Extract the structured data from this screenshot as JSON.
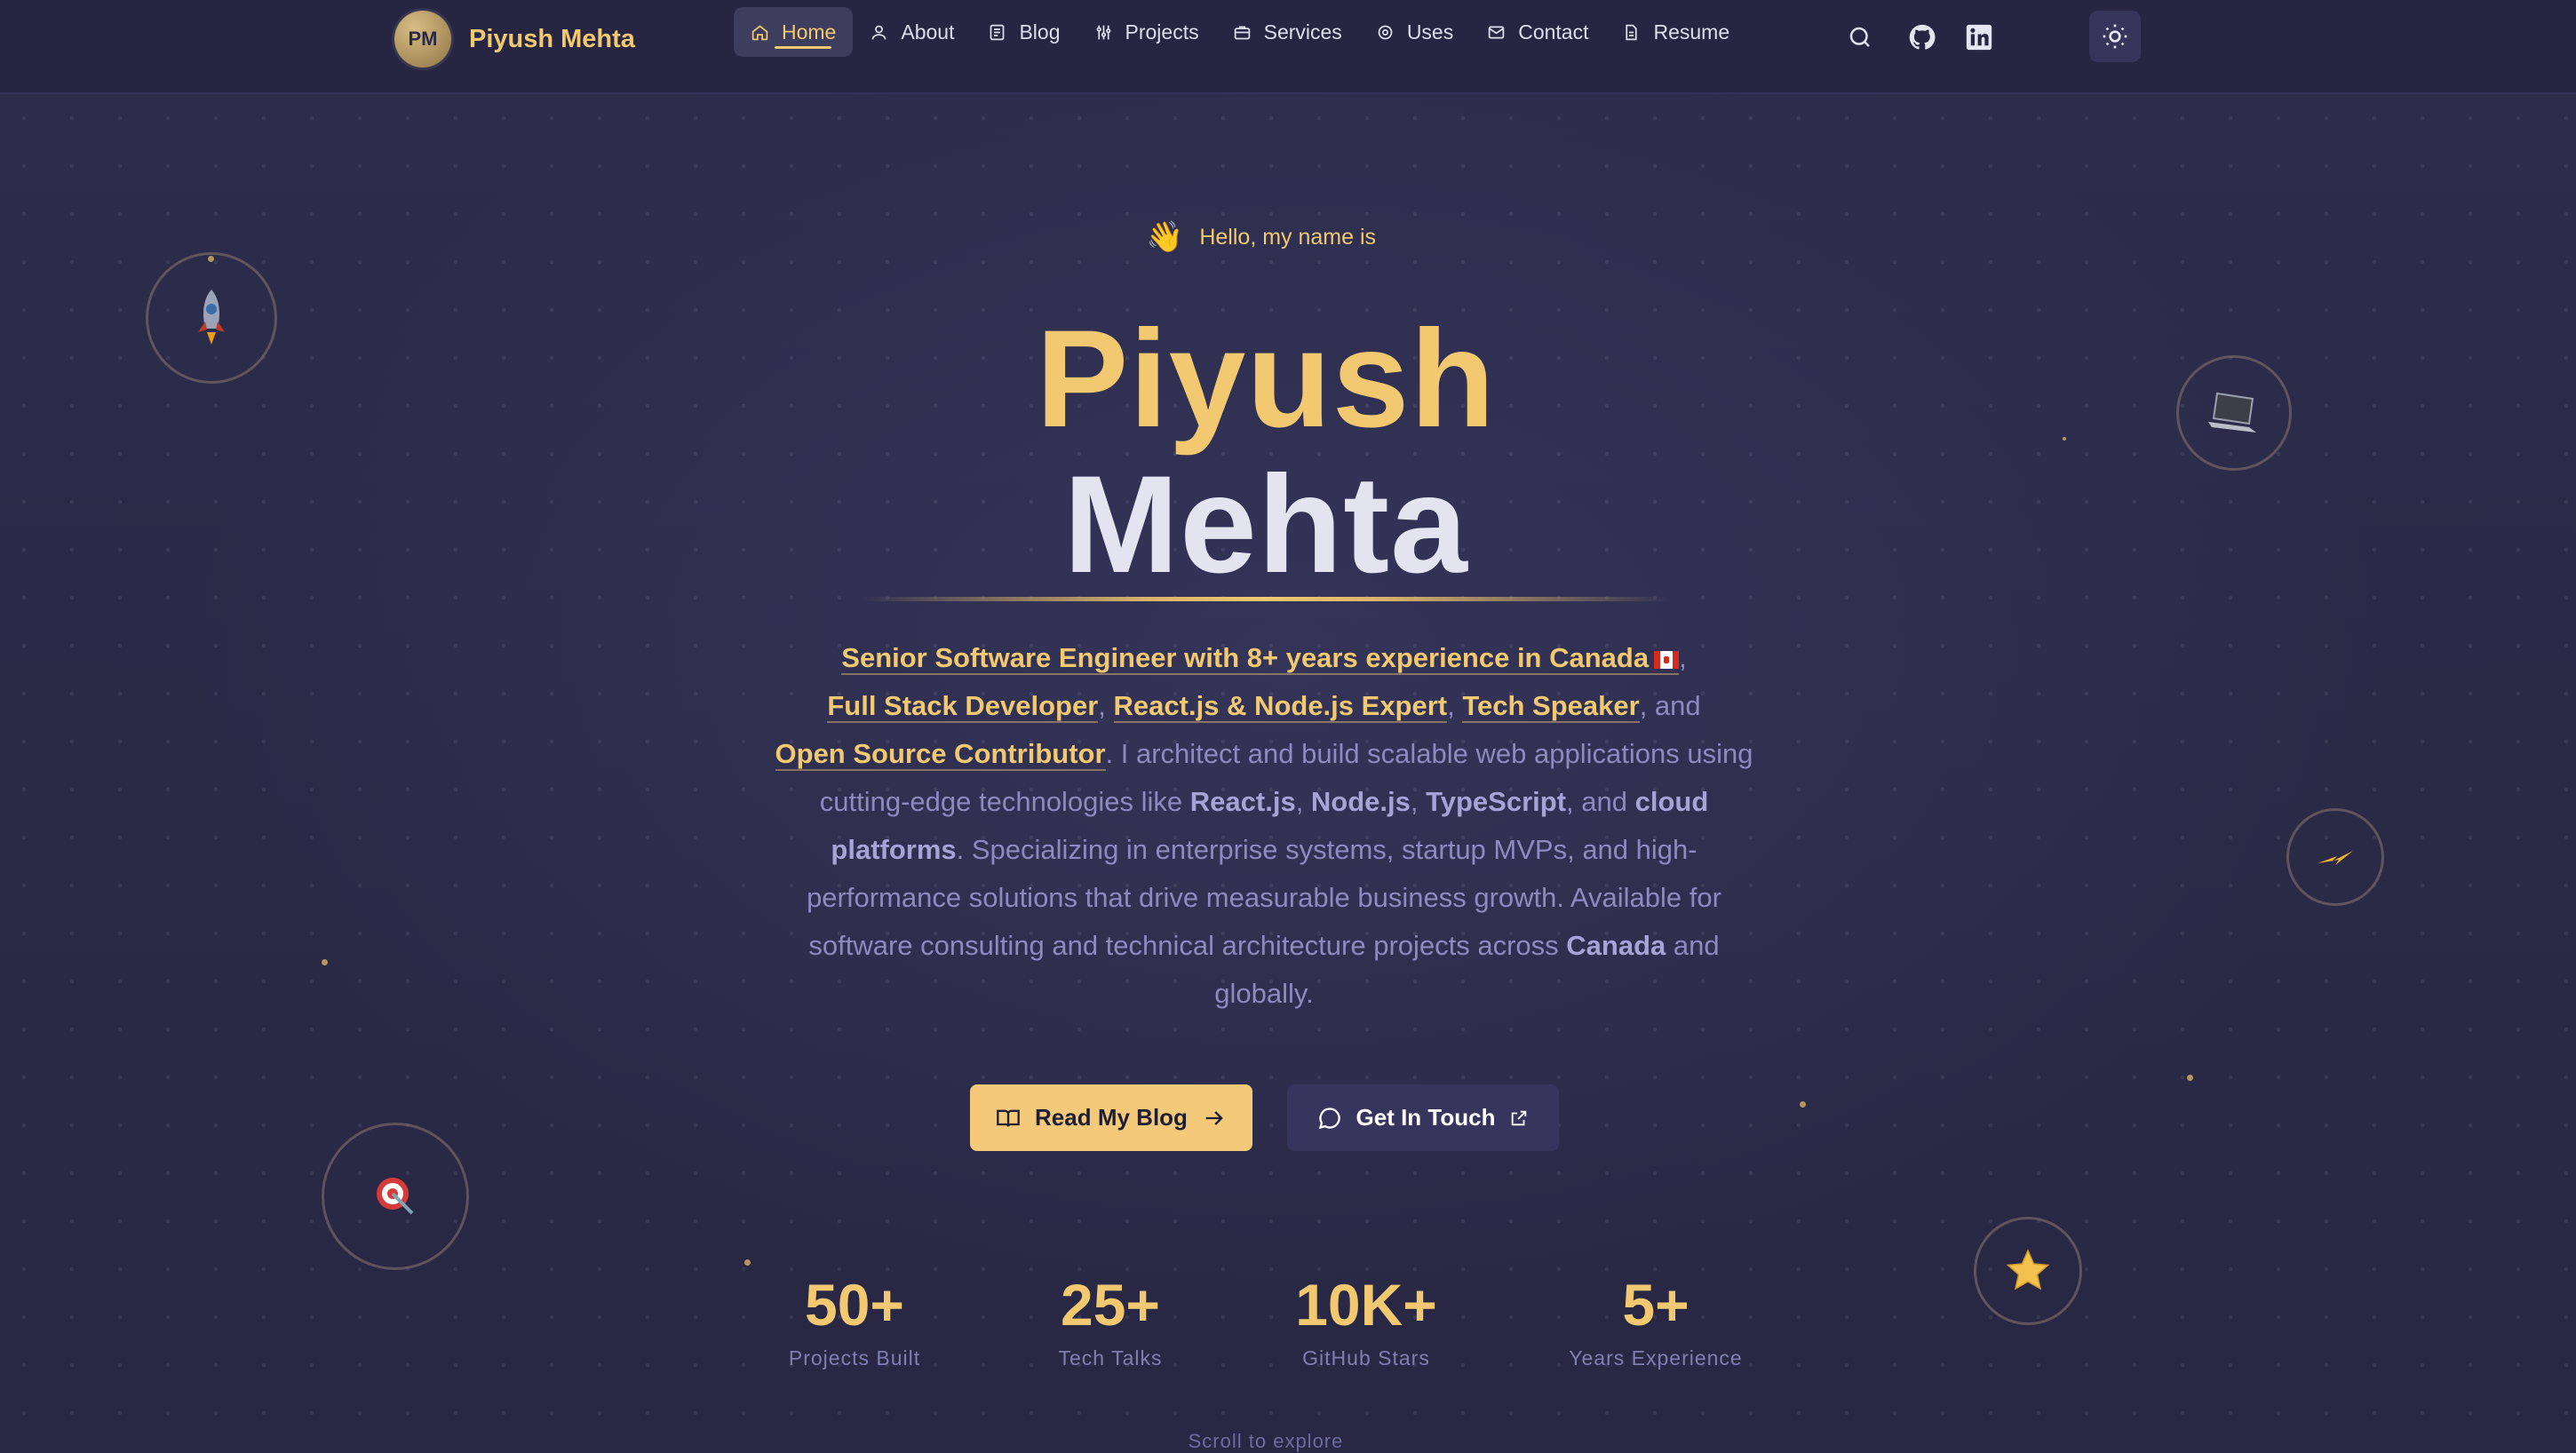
{
  "header": {
    "brand_initials": "PM",
    "brand_name": "Piyush Mehta",
    "nav": [
      {
        "label": "Home",
        "icon": "home-icon",
        "active": true
      },
      {
        "label": "About",
        "icon": "user-icon"
      },
      {
        "label": "Blog",
        "icon": "newspaper-icon"
      },
      {
        "label": "Projects",
        "icon": "sliders-icon"
      },
      {
        "label": "Services",
        "icon": "briefcase-icon"
      },
      {
        "label": "Uses",
        "icon": "gear-icon"
      },
      {
        "label": "Contact",
        "icon": "mail-icon"
      },
      {
        "label": "Resume",
        "icon": "document-icon"
      }
    ],
    "utility_icons": [
      "search-icon",
      "github-icon",
      "linkedin-icon",
      "sun-icon"
    ]
  },
  "hero": {
    "greeting": "Hello, my name is",
    "greeting_emoji": "👋",
    "first_name": "Piyush",
    "last_name": "Mehta",
    "roles": {
      "role1": "Senior Software Engineer with 8+ years experience in Canada",
      "role2": "Full Stack Developer",
      "role3": "React.js & Node.js Expert",
      "role4": "Tech Speaker",
      "role5": "Open Source Contributor",
      "sep_comma": ",",
      "sep_and": ", and"
    },
    "description": {
      "p1": ". I architect and build scalable web applications using cutting-edge technologies like ",
      "tech1": "React.js",
      "c1": ", ",
      "tech2": "Node.js",
      "c2": ", ",
      "tech3": "TypeScript",
      "c3": ", and ",
      "tech4": "cloud platforms",
      "p2": ". Specializing in enterprise systems, startup MVPs, and high-performance solutions that drive measurable business growth. Available for software consulting and technical architecture projects across ",
      "place": "Canada",
      "p3": " and globally."
    },
    "cta_primary": "Read My Blog",
    "cta_secondary": "Get In Touch"
  },
  "stats": [
    {
      "value": "50+",
      "label": "Projects Built"
    },
    {
      "value": "25+",
      "label": "Tech Talks"
    },
    {
      "value": "10K+",
      "label": "GitHub Stars"
    },
    {
      "value": "5+",
      "label": "Years Experience"
    }
  ],
  "scroll_hint": "Scroll to explore",
  "floating_icons": [
    "rocket-icon",
    "laptop-icon",
    "lightning-icon",
    "target-icon",
    "star-icon"
  ],
  "colors": {
    "accent": "#f2c870",
    "background": "#2a2a48",
    "nav_background": "#262643",
    "muted_text": "#8b8bc0"
  }
}
